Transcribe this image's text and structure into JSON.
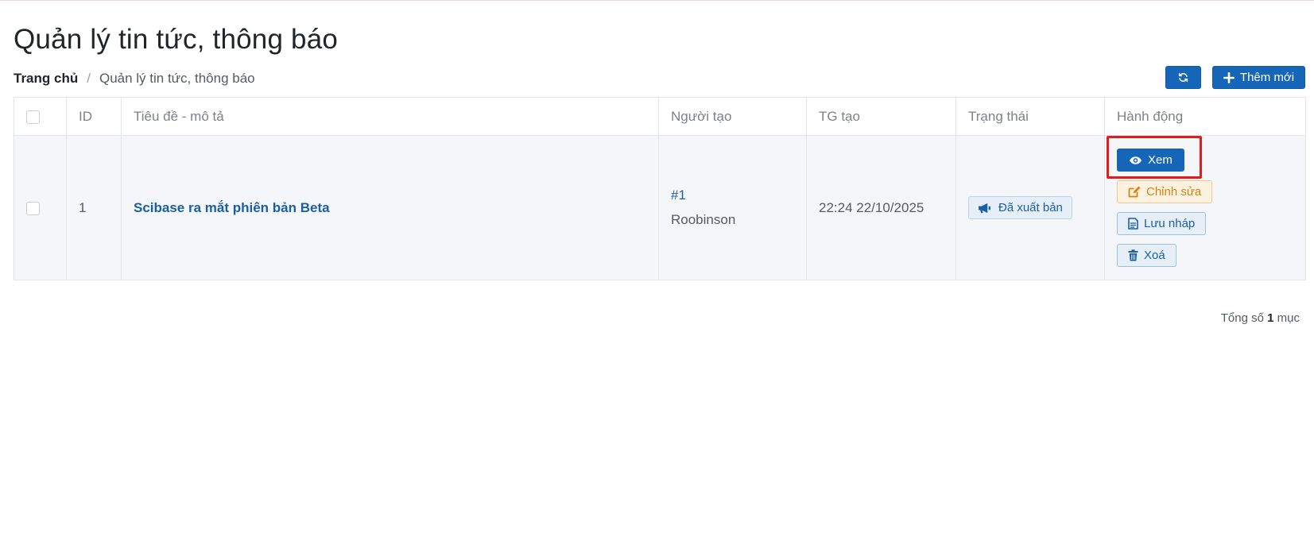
{
  "page": {
    "title": "Quản lý tin tức, thông báo"
  },
  "breadcrumb": {
    "home": "Trang chủ",
    "separator": "/",
    "current": "Quản lý tin tức, thông báo"
  },
  "toolbar": {
    "refresh_icon": "refresh-icon",
    "add_label": "Thêm mới"
  },
  "table": {
    "columns": [
      "ID",
      "Tiêu đề - mô tả",
      "Người tạo",
      "TG tạo",
      "Trạng thái",
      "Hành động"
    ],
    "rows": [
      {
        "id": "1",
        "title": "Scibase ra mắt phiên bản Beta",
        "creator_id": "#1",
        "creator_name": "Roobinson",
        "created_at": "22:24 22/10/2025",
        "status": "Đã xuất bản",
        "actions": {
          "view": "Xem",
          "edit": "Chỉnh sửa",
          "draft": "Lưu nháp",
          "delete": "Xoá"
        }
      }
    ]
  },
  "footer": {
    "total_prefix": "Tổng số",
    "total_count": "1",
    "total_suffix": "mục"
  },
  "colors": {
    "primary": "#1565b8",
    "warning": "#d2850f",
    "highlight": "#e51a1a"
  }
}
